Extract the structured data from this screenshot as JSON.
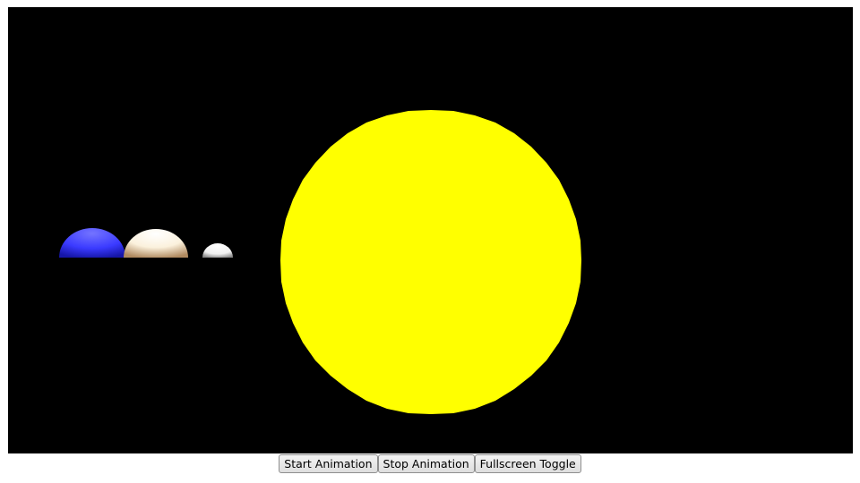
{
  "scene": {
    "background_color": "#000000",
    "bodies": [
      {
        "name": "sun",
        "color": "#ffff00"
      },
      {
        "name": "blue-planet",
        "color": "#4444ff"
      },
      {
        "name": "cream-planet",
        "color": "#fff6dc"
      },
      {
        "name": "white-planet",
        "color": "#ffffff"
      }
    ]
  },
  "controls": {
    "start_label": "Start Animation",
    "stop_label": "Stop Animation",
    "fullscreen_label": "Fullscreen Toggle"
  }
}
